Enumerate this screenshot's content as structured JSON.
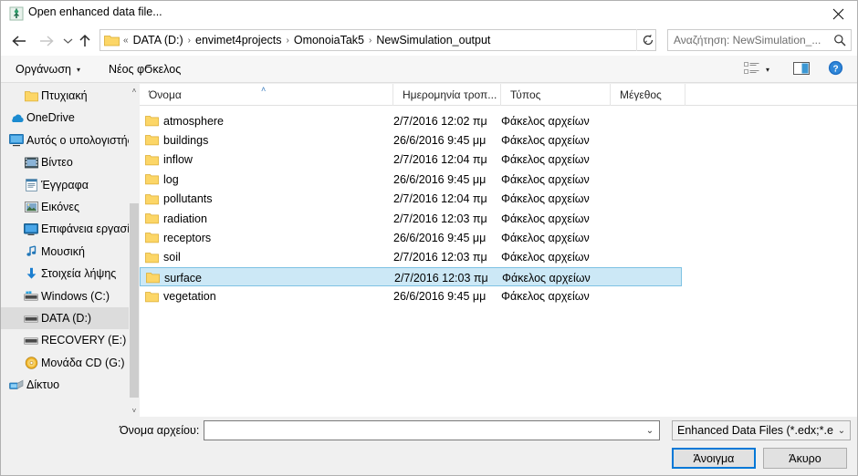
{
  "window": {
    "title": "Open enhanced data file...",
    "app_icon": "envimet-app-icon",
    "close_label": "✕"
  },
  "nav": {
    "back_icon": "back-arrow-icon",
    "forward_icon": "forward-arrow-icon",
    "history_icon": "chevron-down-icon",
    "up_icon": "up-arrow-icon",
    "refresh_icon": "refresh-icon"
  },
  "address": {
    "folder_icon": "folder-icon",
    "root_sep": "«",
    "crumbs": [
      "DATA (D:)",
      "envimet4projects",
      "OmonoiaTak5",
      "NewSimulation_output"
    ],
    "separator": "›",
    "dropdown_icon": "⌄"
  },
  "search": {
    "placeholder": "Αναζήτηση: NewSimulation_...",
    "icon": "search-icon"
  },
  "toolbar": {
    "organize_label": "Οργάνωση",
    "organize_caret": "▾",
    "new_folder_label": "Νέος φϬκελος",
    "view_icon": "view-options-icon",
    "view_caret": "▾",
    "preview_pane_icon": "preview-pane-icon",
    "help_icon": "help-icon"
  },
  "sidebar": {
    "items": [
      {
        "label": "Πτυχιακή",
        "icon": "folder-icon",
        "indent": 1,
        "selected": false
      },
      {
        "label": "OneDrive",
        "icon": "onedrive-icon",
        "indent": 0,
        "selected": false
      },
      {
        "label": "Αυτός ο υπολογιστής",
        "icon": "this-pc-icon",
        "indent": 0,
        "selected": false
      },
      {
        "label": "Βίντεο",
        "icon": "videos-icon",
        "indent": 1,
        "selected": false
      },
      {
        "label": "Έγγραφα",
        "icon": "documents-icon",
        "indent": 1,
        "selected": false
      },
      {
        "label": "Εικόνες",
        "icon": "pictures-icon",
        "indent": 1,
        "selected": false
      },
      {
        "label": "Επιφάνεια εργασίας",
        "icon": "desktop-icon",
        "indent": 1,
        "selected": false
      },
      {
        "label": "Μουσική",
        "icon": "music-icon",
        "indent": 1,
        "selected": false
      },
      {
        "label": "Στοιχεία λήψης",
        "icon": "downloads-icon",
        "indent": 1,
        "selected": false
      },
      {
        "label": "Windows (C:)",
        "icon": "windows-drive-icon",
        "indent": 1,
        "selected": false
      },
      {
        "label": "DATA (D:)",
        "icon": "drive-icon",
        "indent": 1,
        "selected": true
      },
      {
        "label": "RECOVERY (E:)",
        "icon": "drive-icon",
        "indent": 1,
        "selected": false
      },
      {
        "label": "Μονάδα CD (G:)",
        "icon": "cd-drive-icon",
        "indent": 1,
        "selected": false
      },
      {
        "label": "Δίκτυο",
        "icon": "network-icon",
        "indent": 0,
        "selected": false
      }
    ],
    "scroll_up_icon": "˄",
    "scroll_down_icon": "˅"
  },
  "filelist": {
    "columns": [
      {
        "label": "Όνομα",
        "sorted": true,
        "sort_caret": "˄"
      },
      {
        "label": "Ημερομηνία τροπ...",
        "sorted": false,
        "sort_caret": ""
      },
      {
        "label": "Τύπος",
        "sorted": false,
        "sort_caret": ""
      },
      {
        "label": "Μέγεθος",
        "sorted": false,
        "sort_caret": ""
      }
    ],
    "rows": [
      {
        "name": "atmosphere",
        "date": "2/7/2016 12:02 πμ",
        "type": "Φάκελος αρχείων",
        "size": "",
        "icon": "folder-icon",
        "selected": false
      },
      {
        "name": "buildings",
        "date": "26/6/2016 9:45 μμ",
        "type": "Φάκελος αρχείων",
        "size": "",
        "icon": "folder-icon",
        "selected": false
      },
      {
        "name": "inflow",
        "date": "2/7/2016 12:04 πμ",
        "type": "Φάκελος αρχείων",
        "size": "",
        "icon": "folder-icon",
        "selected": false
      },
      {
        "name": "log",
        "date": "26/6/2016 9:45 μμ",
        "type": "Φάκελος αρχείων",
        "size": "",
        "icon": "folder-icon",
        "selected": false
      },
      {
        "name": "pollutants",
        "date": "2/7/2016 12:04 πμ",
        "type": "Φάκελος αρχείων",
        "size": "",
        "icon": "folder-icon",
        "selected": false
      },
      {
        "name": "radiation",
        "date": "2/7/2016 12:03 πμ",
        "type": "Φάκελος αρχείων",
        "size": "",
        "icon": "folder-icon",
        "selected": false
      },
      {
        "name": "receptors",
        "date": "26/6/2016 9:45 μμ",
        "type": "Φάκελος αρχείων",
        "size": "",
        "icon": "folder-icon",
        "selected": false
      },
      {
        "name": "soil",
        "date": "2/7/2016 12:03 πμ",
        "type": "Φάκελος αρχείων",
        "size": "",
        "icon": "folder-icon",
        "selected": false
      },
      {
        "name": "surface",
        "date": "2/7/2016 12:03 πμ",
        "type": "Φάκελος αρχείων",
        "size": "",
        "icon": "folder-icon",
        "selected": true
      },
      {
        "name": "vegetation",
        "date": "26/6/2016 9:45 μμ",
        "type": "Φάκελος αρχείων",
        "size": "",
        "icon": "folder-icon",
        "selected": false
      }
    ]
  },
  "footer": {
    "filename_label": "Όνομα αρχείου:",
    "filename_value": "",
    "filename_arrow": "⌄",
    "filter_value": "Enhanced Data Files (*.edx;*.edi",
    "filter_arrow": "⌄",
    "open_label": "Άνοιγμα",
    "cancel_label": "Άκυρο"
  },
  "colors": {
    "accent": "#0078d7",
    "selection_fill": "#cce8f6",
    "selection_border": "#7ec2e3",
    "folder_yellow": "#fcd667",
    "chrome": "#f0f0f0"
  }
}
